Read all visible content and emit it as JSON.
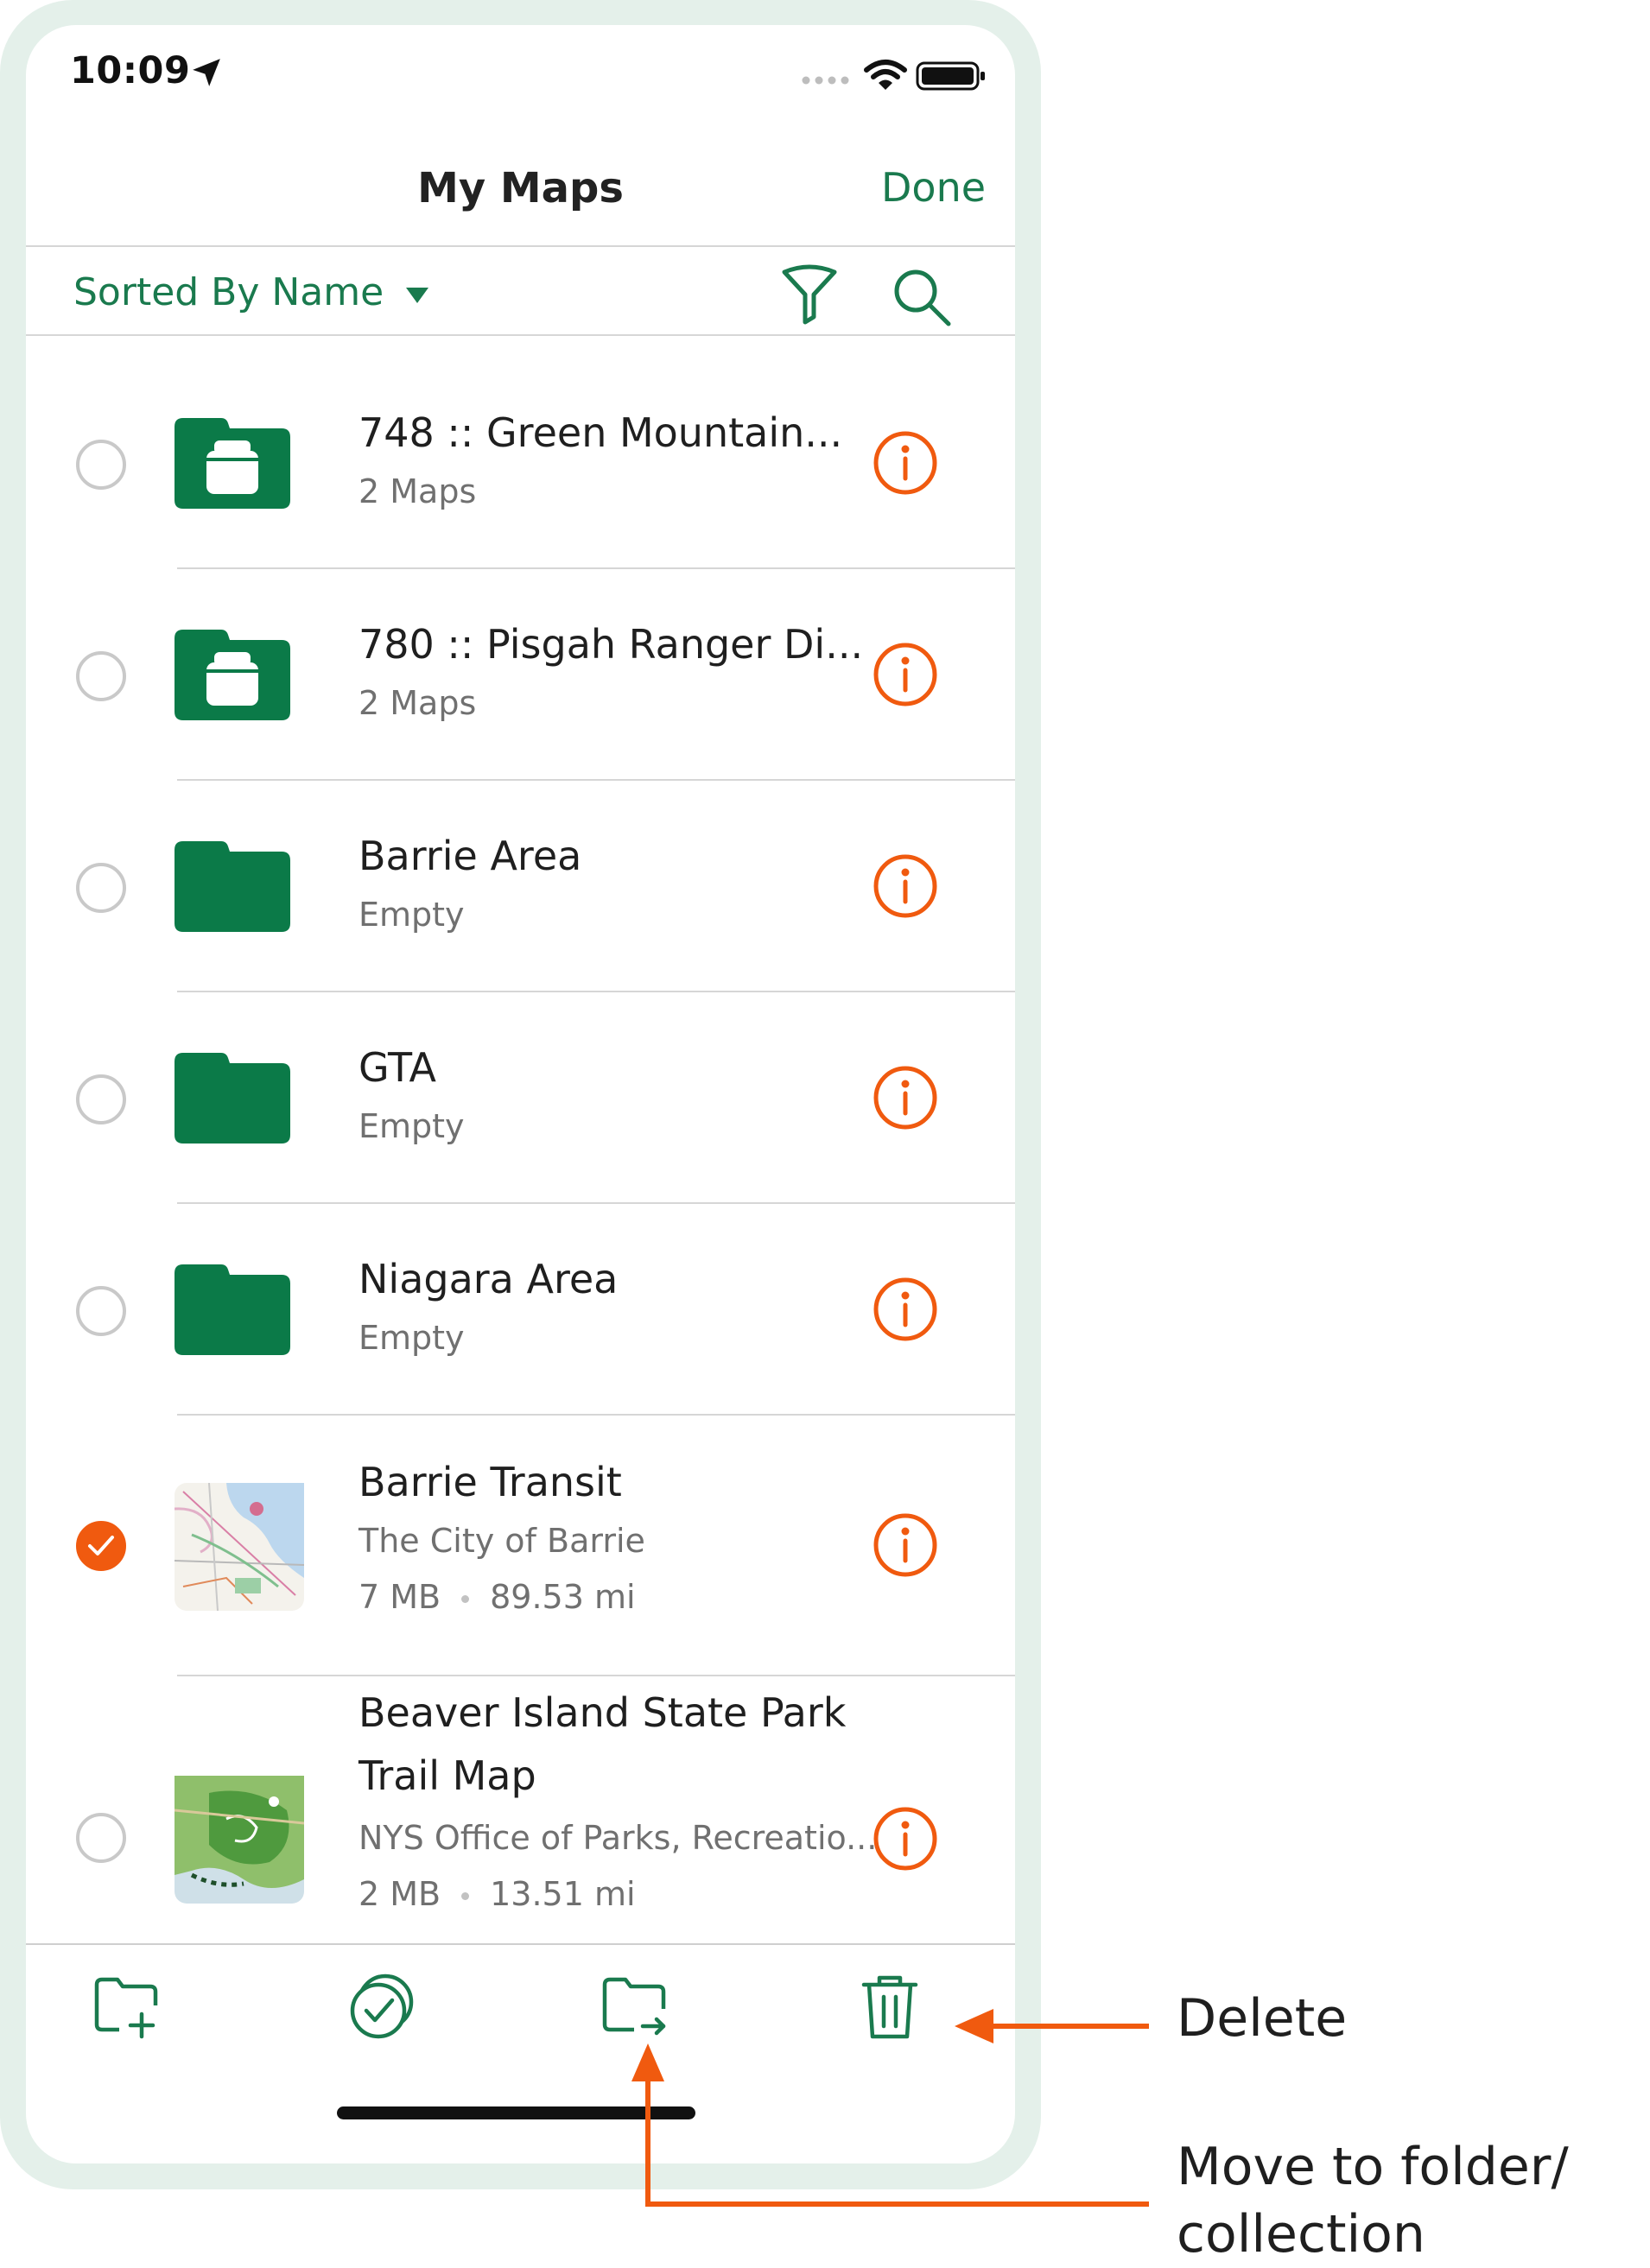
{
  "status_bar": {
    "time": "10:09"
  },
  "nav": {
    "title": "My Maps",
    "done_label": "Done"
  },
  "sort": {
    "label": "Sorted By Name"
  },
  "items": [
    {
      "title": "748 :: Green Mountain...",
      "subtitle": "2 Maps",
      "type": "collection",
      "selected": false
    },
    {
      "title": "780 :: Pisgah Ranger Di...",
      "subtitle": "2 Maps",
      "type": "collection",
      "selected": false
    },
    {
      "title": "Barrie Area",
      "subtitle": "Empty",
      "type": "folder",
      "selected": false
    },
    {
      "title": "GTA",
      "subtitle": "Empty",
      "type": "folder",
      "selected": false
    },
    {
      "title": "Niagara Area",
      "subtitle": "Empty",
      "type": "folder",
      "selected": false
    },
    {
      "title": "Barrie Transit",
      "publisher": "The City of Barrie",
      "size": "7 MB",
      "distance": "89.53 mi",
      "type": "map",
      "selected": true
    },
    {
      "title_line1": "Beaver Island State Park",
      "title_line2": "Trail Map",
      "publisher": "NYS Office of Parks, Recreatio...",
      "size": "2 MB",
      "distance": "13.51 mi",
      "type": "map",
      "selected": false
    }
  ],
  "toolbar": {
    "buttons": [
      "new-folder-icon",
      "select-all-icon",
      "move-to-folder-icon",
      "trash-icon"
    ]
  },
  "annotations": {
    "delete": "Delete",
    "move_line1": "Move to folder/",
    "move_line2": "collection"
  },
  "colors": {
    "brand_green": "#1a7a4e",
    "folder_green": "#0b7a48",
    "accent_orange": "#f05a0f",
    "frame": "#e4f0ea"
  }
}
